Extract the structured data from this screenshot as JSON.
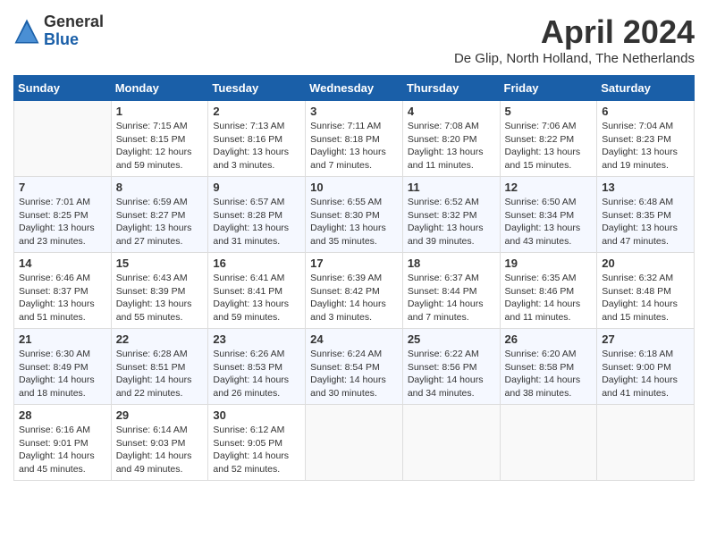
{
  "app": {
    "logo_general": "General",
    "logo_blue": "Blue",
    "month": "April 2024",
    "location": "De Glip, North Holland, The Netherlands"
  },
  "calendar": {
    "headers": [
      "Sunday",
      "Monday",
      "Tuesday",
      "Wednesday",
      "Thursday",
      "Friday",
      "Saturday"
    ],
    "weeks": [
      [
        {
          "day": "",
          "info": ""
        },
        {
          "day": "1",
          "info": "Sunrise: 7:15 AM\nSunset: 8:15 PM\nDaylight: 12 hours\nand 59 minutes."
        },
        {
          "day": "2",
          "info": "Sunrise: 7:13 AM\nSunset: 8:16 PM\nDaylight: 13 hours\nand 3 minutes."
        },
        {
          "day": "3",
          "info": "Sunrise: 7:11 AM\nSunset: 8:18 PM\nDaylight: 13 hours\nand 7 minutes."
        },
        {
          "day": "4",
          "info": "Sunrise: 7:08 AM\nSunset: 8:20 PM\nDaylight: 13 hours\nand 11 minutes."
        },
        {
          "day": "5",
          "info": "Sunrise: 7:06 AM\nSunset: 8:22 PM\nDaylight: 13 hours\nand 15 minutes."
        },
        {
          "day": "6",
          "info": "Sunrise: 7:04 AM\nSunset: 8:23 PM\nDaylight: 13 hours\nand 19 minutes."
        }
      ],
      [
        {
          "day": "7",
          "info": "Sunrise: 7:01 AM\nSunset: 8:25 PM\nDaylight: 13 hours\nand 23 minutes."
        },
        {
          "day": "8",
          "info": "Sunrise: 6:59 AM\nSunset: 8:27 PM\nDaylight: 13 hours\nand 27 minutes."
        },
        {
          "day": "9",
          "info": "Sunrise: 6:57 AM\nSunset: 8:28 PM\nDaylight: 13 hours\nand 31 minutes."
        },
        {
          "day": "10",
          "info": "Sunrise: 6:55 AM\nSunset: 8:30 PM\nDaylight: 13 hours\nand 35 minutes."
        },
        {
          "day": "11",
          "info": "Sunrise: 6:52 AM\nSunset: 8:32 PM\nDaylight: 13 hours\nand 39 minutes."
        },
        {
          "day": "12",
          "info": "Sunrise: 6:50 AM\nSunset: 8:34 PM\nDaylight: 13 hours\nand 43 minutes."
        },
        {
          "day": "13",
          "info": "Sunrise: 6:48 AM\nSunset: 8:35 PM\nDaylight: 13 hours\nand 47 minutes."
        }
      ],
      [
        {
          "day": "14",
          "info": "Sunrise: 6:46 AM\nSunset: 8:37 PM\nDaylight: 13 hours\nand 51 minutes."
        },
        {
          "day": "15",
          "info": "Sunrise: 6:43 AM\nSunset: 8:39 PM\nDaylight: 13 hours\nand 55 minutes."
        },
        {
          "day": "16",
          "info": "Sunrise: 6:41 AM\nSunset: 8:41 PM\nDaylight: 13 hours\nand 59 minutes."
        },
        {
          "day": "17",
          "info": "Sunrise: 6:39 AM\nSunset: 8:42 PM\nDaylight: 14 hours\nand 3 minutes."
        },
        {
          "day": "18",
          "info": "Sunrise: 6:37 AM\nSunset: 8:44 PM\nDaylight: 14 hours\nand 7 minutes."
        },
        {
          "day": "19",
          "info": "Sunrise: 6:35 AM\nSunset: 8:46 PM\nDaylight: 14 hours\nand 11 minutes."
        },
        {
          "day": "20",
          "info": "Sunrise: 6:32 AM\nSunset: 8:48 PM\nDaylight: 14 hours\nand 15 minutes."
        }
      ],
      [
        {
          "day": "21",
          "info": "Sunrise: 6:30 AM\nSunset: 8:49 PM\nDaylight: 14 hours\nand 18 minutes."
        },
        {
          "day": "22",
          "info": "Sunrise: 6:28 AM\nSunset: 8:51 PM\nDaylight: 14 hours\nand 22 minutes."
        },
        {
          "day": "23",
          "info": "Sunrise: 6:26 AM\nSunset: 8:53 PM\nDaylight: 14 hours\nand 26 minutes."
        },
        {
          "day": "24",
          "info": "Sunrise: 6:24 AM\nSunset: 8:54 PM\nDaylight: 14 hours\nand 30 minutes."
        },
        {
          "day": "25",
          "info": "Sunrise: 6:22 AM\nSunset: 8:56 PM\nDaylight: 14 hours\nand 34 minutes."
        },
        {
          "day": "26",
          "info": "Sunrise: 6:20 AM\nSunset: 8:58 PM\nDaylight: 14 hours\nand 38 minutes."
        },
        {
          "day": "27",
          "info": "Sunrise: 6:18 AM\nSunset: 9:00 PM\nDaylight: 14 hours\nand 41 minutes."
        }
      ],
      [
        {
          "day": "28",
          "info": "Sunrise: 6:16 AM\nSunset: 9:01 PM\nDaylight: 14 hours\nand 45 minutes."
        },
        {
          "day": "29",
          "info": "Sunrise: 6:14 AM\nSunset: 9:03 PM\nDaylight: 14 hours\nand 49 minutes."
        },
        {
          "day": "30",
          "info": "Sunrise: 6:12 AM\nSunset: 9:05 PM\nDaylight: 14 hours\nand 52 minutes."
        },
        {
          "day": "",
          "info": ""
        },
        {
          "day": "",
          "info": ""
        },
        {
          "day": "",
          "info": ""
        },
        {
          "day": "",
          "info": ""
        }
      ]
    ]
  }
}
